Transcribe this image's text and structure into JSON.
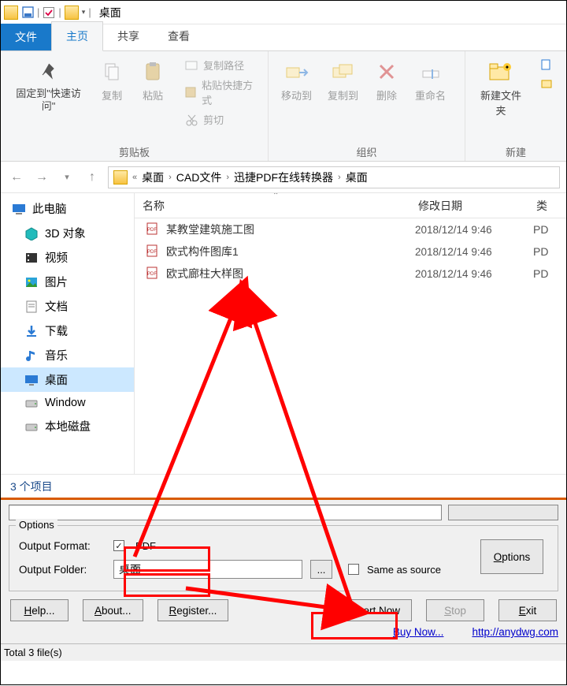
{
  "titlebar": {
    "title": "桌面"
  },
  "tabs": {
    "file": "文件",
    "home": "主页",
    "share": "共享",
    "view": "查看"
  },
  "ribbon": {
    "pin": "固定到\"快速访问\"",
    "copy": "复制",
    "paste": "粘贴",
    "copypath": "复制路径",
    "pasteshortcut": "粘贴快捷方式",
    "cut": "剪切",
    "group_clipboard": "剪贴板",
    "moveto": "移动到",
    "copyto": "复制到",
    "delete": "删除",
    "rename": "重命名",
    "group_organize": "组织",
    "newfolder": "新建文件夹",
    "group_new": "新建"
  },
  "breadcrumb": {
    "sep": "«",
    "parts": [
      "桌面",
      "CAD文件",
      "迅捷PDF在线转换器",
      "桌面"
    ]
  },
  "sidebar": {
    "root": "此电脑",
    "items": [
      {
        "label": "3D 对象",
        "icon": "cube"
      },
      {
        "label": "视频",
        "icon": "video"
      },
      {
        "label": "图片",
        "icon": "picture"
      },
      {
        "label": "文档",
        "icon": "doc"
      },
      {
        "label": "下载",
        "icon": "download"
      },
      {
        "label": "音乐",
        "icon": "music"
      },
      {
        "label": "桌面",
        "icon": "desktop",
        "selected": true
      },
      {
        "label": "Window",
        "icon": "drive"
      },
      {
        "label": "本地磁盘",
        "icon": "drive"
      }
    ]
  },
  "filelist": {
    "col_name": "名称",
    "col_date": "修改日期",
    "col_type": "类",
    "rows": [
      {
        "name": "某教堂建筑施工图",
        "date": "2018/12/14 9:46",
        "type": "PD"
      },
      {
        "name": "欧式构件图库1",
        "date": "2018/12/14 9:46",
        "type": "PD"
      },
      {
        "name": "欧式廊柱大样图",
        "date": "2018/12/14 9:46",
        "type": "PD"
      }
    ]
  },
  "status1": "3 个项目",
  "app": {
    "options_legend": "Options",
    "output_format_label": "Output Format:",
    "output_format_value": "PDF",
    "output_folder_label": "Output Folder:",
    "output_folder_value": "桌面",
    "browse": "...",
    "same_as_source": "Same as source",
    "options_btn": "Options",
    "help": "Help...",
    "about": "About...",
    "register": "Register...",
    "convert": "Convert Now",
    "stop": "Stop",
    "exit": "Exit",
    "buy": "Buy Now...",
    "url": "http://anydwg.com"
  },
  "status2": "Total 3 file(s)"
}
